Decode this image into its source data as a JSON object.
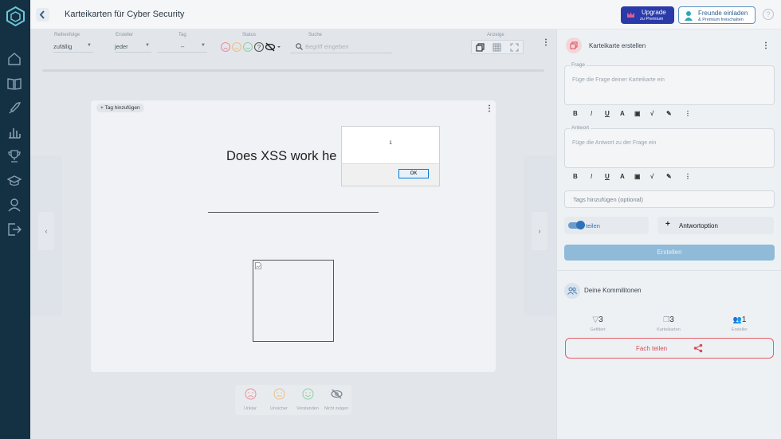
{
  "app": {
    "title": "Karteikarten für Cyber Security"
  },
  "header": {
    "upgrade": {
      "line1": "Upgrade",
      "line2": "zu Premium"
    },
    "invite": {
      "line1": "Freunde einladen",
      "line2": "& Premium freischalten"
    },
    "help": "?"
  },
  "sidebar": {
    "items": [
      "home-icon",
      "book-icon",
      "rocket-icon",
      "chart-icon",
      "trophy-icon",
      "graduation-cap-icon",
      "user-icon",
      "logout-icon"
    ]
  },
  "filters": {
    "order": {
      "label": "Reihenfolge",
      "value": "zufällig"
    },
    "creator": {
      "label": "Ersteller",
      "value": "jeder"
    },
    "tag": {
      "label": "Tag",
      "value": "--"
    },
    "status": {
      "label": "Status"
    },
    "search": {
      "label": "Suche",
      "placeholder": "Begriff eingeben"
    },
    "view": {
      "label": "Anzeige"
    }
  },
  "card": {
    "tag_button": "+ Tag hinzufügen",
    "question": "Does XSS work he"
  },
  "rating": {
    "items": [
      {
        "label": "Unklar",
        "color": "#e8919a"
      },
      {
        "label": "Unsicher",
        "color": "#e9c08a"
      },
      {
        "label": "Verstanden",
        "color": "#8fd0a6"
      },
      {
        "label": "Nicht zeigen",
        "color": "#7a8590"
      }
    ]
  },
  "create": {
    "title": "Karteikarte erstellen",
    "question_label": "Frage",
    "question_placeholder": "Füge die Frage deiner Karteikarte ein",
    "answer_label": "Antwort",
    "answer_placeholder": "Füge die Antwort zu der Frage ein",
    "tags_placeholder": "Tags hinzufügen (optional)",
    "share_label": "teilen",
    "answer_option": "Antwortoption",
    "submit": "Erstellen",
    "toolbar": [
      "B",
      "I",
      "U",
      "A",
      "img",
      "√",
      "pen",
      "⋮"
    ]
  },
  "community": {
    "title": "Deine Kommilitonen",
    "stats": [
      {
        "value": "3",
        "label": "Gefiltert"
      },
      {
        "value": "3",
        "label": "Karteikarten"
      },
      {
        "value": "1",
        "label": "Ersteller"
      }
    ],
    "share_button": "Fach teilen"
  },
  "dialog": {
    "message": "1",
    "ok": "OK"
  }
}
